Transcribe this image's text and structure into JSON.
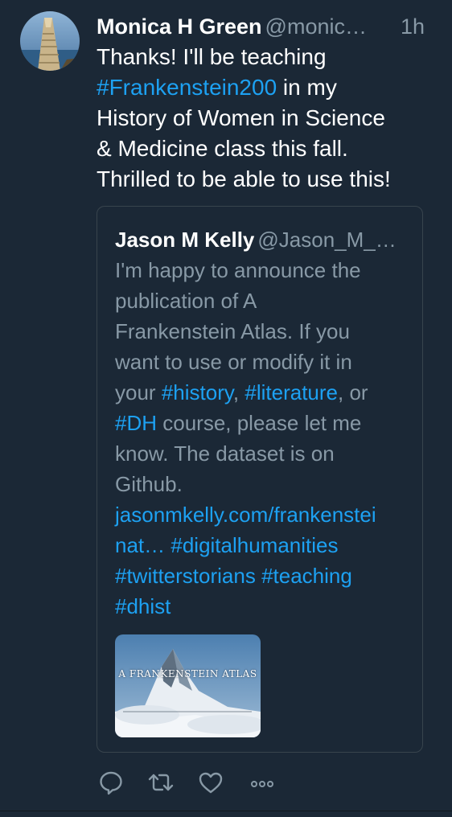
{
  "tweet": {
    "author_name": "Monica H Green",
    "author_handle": "@monic…",
    "time": "1h",
    "text_lines": [
      {
        "before": "Thanks! I'll be teaching",
        "link": "",
        "after": ""
      },
      {
        "before": "",
        "link": "#Frankenstein200",
        "after": " in my"
      },
      {
        "before": "History of Women in Science",
        "link": "",
        "after": ""
      },
      {
        "before": "& Medicine class this fall.",
        "link": "",
        "after": ""
      },
      {
        "before": "Thrilled to be able to use this!",
        "link": "",
        "after": ""
      }
    ]
  },
  "quoted": {
    "author_name": "Jason M Kelly",
    "author_handle": "@Jason_M_…",
    "text_lines": [
      "I'm happy to announce the",
      "publication of A",
      "Frankenstein Atlas. If you",
      "want to use or modify it in"
    ],
    "line5": {
      "before": "your ",
      "link1": "#history",
      "mid": ", ",
      "link2": "#literature",
      "after": ", or"
    },
    "line6": {
      "link": "#DH",
      "after": " course, please let me"
    },
    "line7": "know. The dataset is on",
    "line8": "Github.",
    "link_lines": [
      "jasonmkelly.com/frankenstei",
      "nat… #digitalhumanities",
      "#twitterstorians #teaching",
      "#dhist"
    ],
    "media_title": "A FRANKENSTEIN ATLAS"
  },
  "actions": {
    "reply_icon": "reply-icon",
    "retweet_icon": "retweet-icon",
    "like_icon": "heart-icon",
    "more_icon": "more-icon"
  },
  "colors": {
    "background": "#1b2836",
    "link": "#1da1f2",
    "secondary_text": "#8899a6",
    "primary_text": "#ffffff"
  }
}
